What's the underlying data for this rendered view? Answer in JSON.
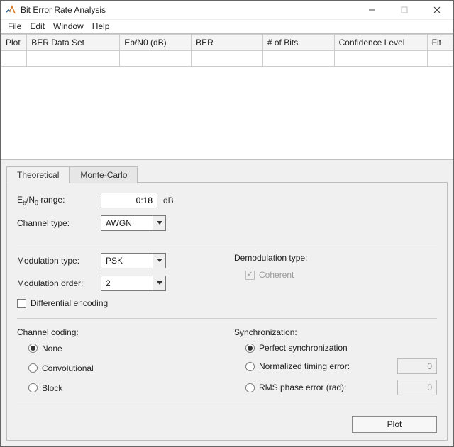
{
  "window": {
    "title": "Bit Error Rate Analysis"
  },
  "menu": {
    "items": [
      "File",
      "Edit",
      "Window",
      "Help"
    ]
  },
  "table": {
    "headers": [
      "Plot",
      "BER Data Set",
      "Eb/N0 (dB)",
      "BER",
      "# of Bits",
      "Confidence Level",
      "Fit"
    ]
  },
  "tabs": {
    "theoretical": "Theoretical",
    "montecarlo": "Monte-Carlo"
  },
  "form": {
    "ebn0_label_html": "E<sub>b</sub>/N<sub>0</sub> range:",
    "ebn0_value": "0:18",
    "ebn0_unit": "dB",
    "channel_type_label": "Channel type:",
    "channel_type_value": "AWGN",
    "modulation_type_label": "Modulation type:",
    "modulation_type_value": "PSK",
    "modulation_order_label": "Modulation order:",
    "modulation_order_value": "2",
    "demodulation_type_label": "Demodulation type:",
    "coherent_label": "Coherent",
    "diff_enc_label": "Differential encoding",
    "channel_coding_label": "Channel coding:",
    "coding_none": "None",
    "coding_conv": "Convolutional",
    "coding_block": "Block",
    "sync_label": "Synchronization:",
    "sync_perfect": "Perfect synchronization",
    "sync_timing": "Normalized timing error:",
    "sync_timing_val": "0",
    "sync_phase": "RMS phase error (rad):",
    "sync_phase_val": "0",
    "plot_btn": "Plot"
  }
}
